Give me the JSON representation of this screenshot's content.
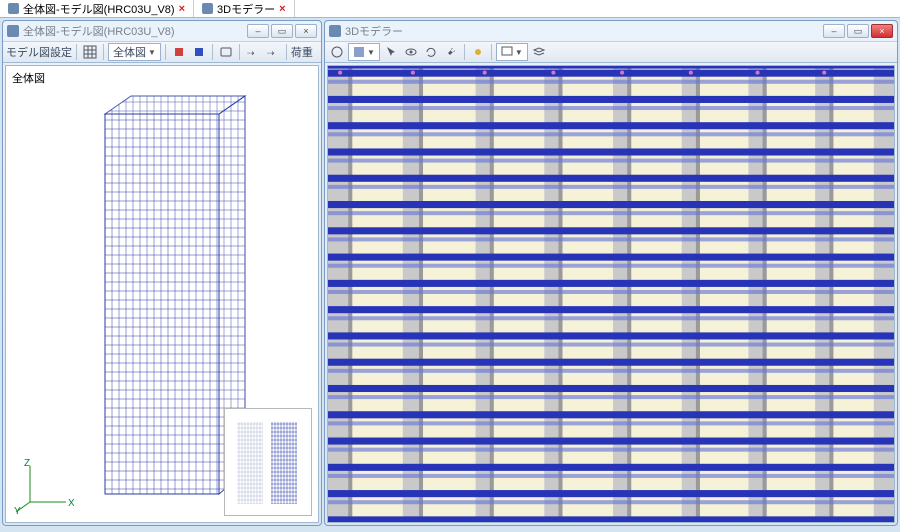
{
  "tabs": [
    {
      "label": "全体図-モデル図(HRC03U_V8)"
    },
    {
      "label": "3Dモデラー"
    }
  ],
  "left": {
    "title": "全体図-モデル図(HRC03U_V8)",
    "toolbar": {
      "model_settings": "モデル図設定",
      "view_dd": "全体図",
      "weight": "荷重"
    },
    "viewport_label": "全体図",
    "axes": {
      "x": "X",
      "y": "Y",
      "z": "Z"
    }
  },
  "right": {
    "title": "3Dモデラー"
  },
  "window_controls": {
    "min": "–",
    "max": "▭",
    "close": "×"
  },
  "colors": {
    "accent": "#2a3aa0",
    "frame": "#7a9cc6",
    "beam": "#2734b8",
    "column": "#c8c8c8"
  }
}
